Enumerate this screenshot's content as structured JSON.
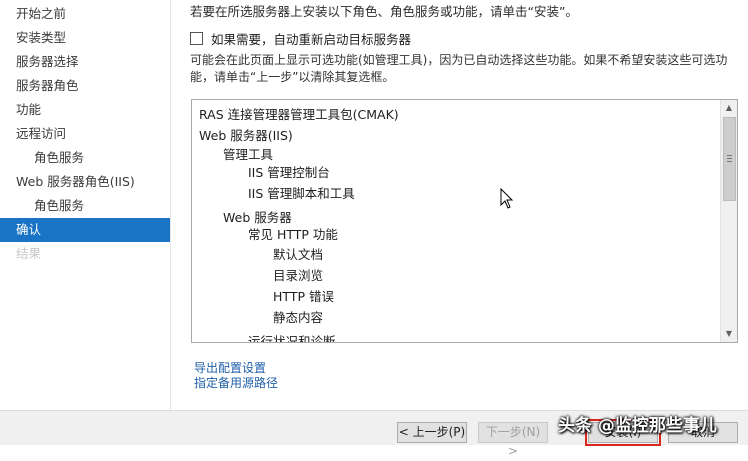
{
  "sidebar": {
    "items": [
      {
        "label": "开始之前",
        "state": "normal"
      },
      {
        "label": "安装类型",
        "state": "normal"
      },
      {
        "label": "服务器选择",
        "state": "normal"
      },
      {
        "label": "服务器角色",
        "state": "normal"
      },
      {
        "label": "功能",
        "state": "normal"
      },
      {
        "label": "远程访问",
        "state": "normal"
      },
      {
        "label": "角色服务",
        "state": "normal",
        "sub": true
      },
      {
        "label": "Web 服务器角色(IIS)",
        "state": "normal"
      },
      {
        "label": "角色服务",
        "state": "normal",
        "sub": true
      },
      {
        "label": "确认",
        "state": "active"
      },
      {
        "label": "结果",
        "state": "disabled"
      }
    ]
  },
  "main": {
    "intro": "若要在所选服务器上安装以下角色、角色服务或功能，请单击“安装”。",
    "restart_label": "如果需要，自动重新启动目标服务器",
    "restart_checked": false,
    "note_line1": "可能会在此页面上显示可选功能(如管理工具)，因为已自动选择这些功能。如果不希望安装这些可选功",
    "note_line2": "能，请单击“上一步”以清除其复选框。",
    "features": [
      {
        "label": "RAS 连接管理器管理工具包(CMAK)",
        "level": 0
      },
      {
        "label": "Web 服务器(IIS)",
        "level": 0
      },
      {
        "label": "管理工具",
        "level": 1
      },
      {
        "label": "IIS 管理控制台",
        "level": 2
      },
      {
        "label": "IIS 管理脚本和工具",
        "level": 2
      },
      {
        "label": "Web 服务器",
        "level": 1
      },
      {
        "label": "常见 HTTP 功能",
        "level": 2
      },
      {
        "label": "默认文档",
        "level": 3
      },
      {
        "label": "目录浏览",
        "level": 3
      },
      {
        "label": "HTTP 错误",
        "level": 3
      },
      {
        "label": "静态内容",
        "level": 3
      },
      {
        "label": "运行状况和诊断",
        "level": 2
      }
    ],
    "export_link": "导出配置设置",
    "alt_source_link": "指定备用源路径"
  },
  "footer": {
    "prev_label": "< 上一步(P)",
    "next_label": "下一步(N) >",
    "install_label": "安装(I)",
    "cancel_label": "取消"
  },
  "watermark": "头条 @监控那些事儿"
}
